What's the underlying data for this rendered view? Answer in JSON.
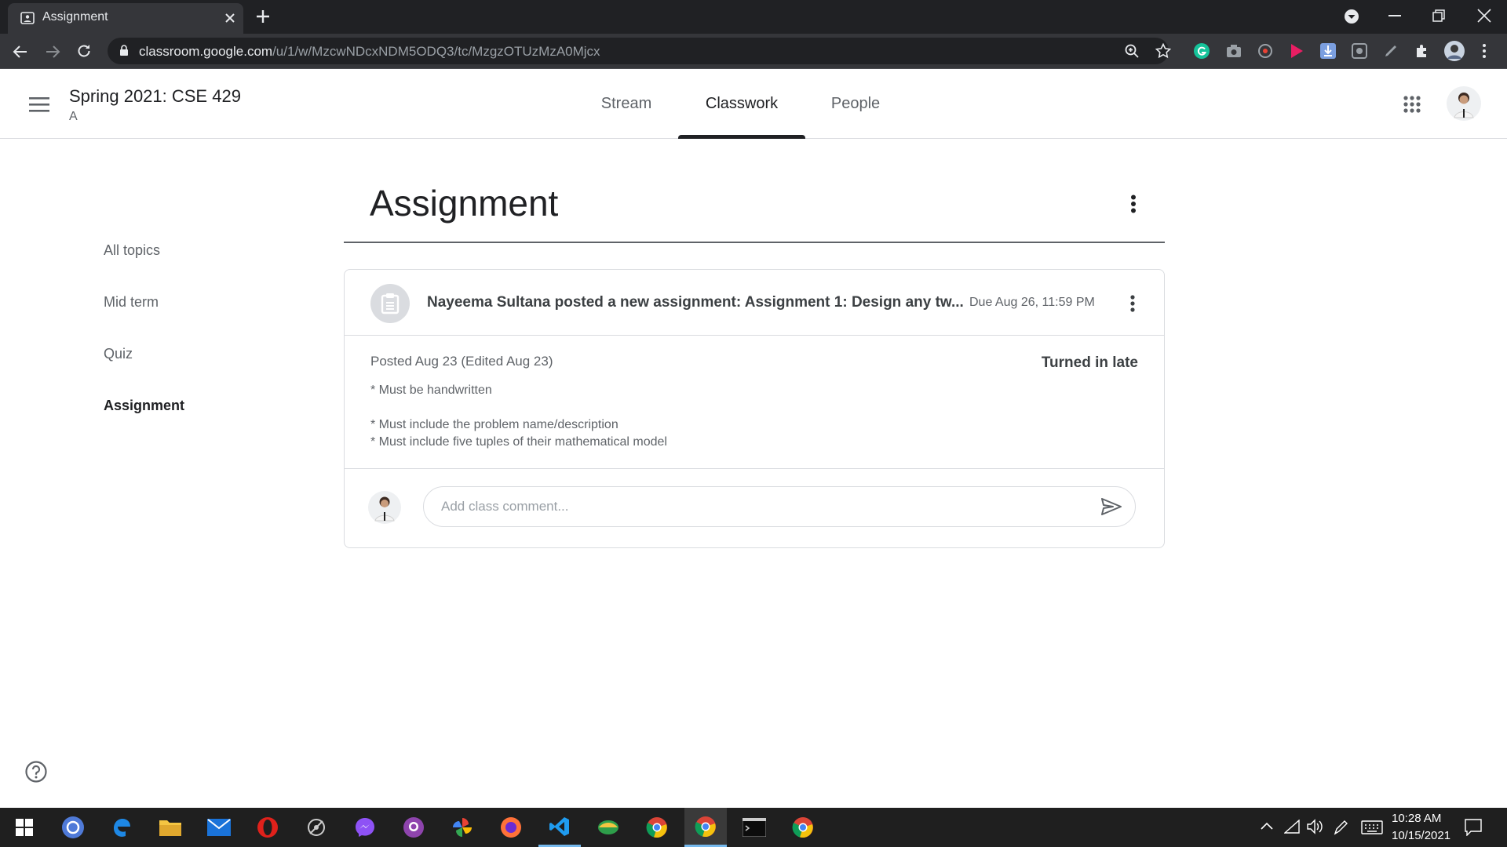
{
  "browser": {
    "tab_title": "Assignment",
    "url_domain": "classroom.google.com",
    "url_path": "/u/1/w/MzcwNDcxNDM5ODQ3/tc/MzgzOTUzMzA0Mjcx"
  },
  "class": {
    "name": "Spring 2021: CSE 429",
    "section": "A"
  },
  "nav_tabs": [
    {
      "label": "Stream"
    },
    {
      "label": "Classwork"
    },
    {
      "label": "People"
    }
  ],
  "topics": [
    {
      "label": "All topics"
    },
    {
      "label": "Mid term"
    },
    {
      "label": "Quiz"
    },
    {
      "label": "Assignment"
    }
  ],
  "section_title": "Assignment",
  "assignment": {
    "headline": "Nayeema Sultana posted a new assignment: Assignment 1: Design any tw...",
    "due": "Due Aug 26, 11:59 PM",
    "posted": "Posted Aug 23 (Edited Aug 23)",
    "status": "Turned in late",
    "instructions": [
      "* Must be handwritten",
      "* Must include the problem name/description",
      "* Must include five tuples of their mathematical model"
    ],
    "comment_placeholder": "Add class comment..."
  },
  "taskbar": {
    "time": "10:28 AM",
    "date": "10/15/2021"
  },
  "colors": {
    "chrome_dark": "#202124",
    "chrome_toolbar": "#35363a",
    "accent_text": "#202124",
    "muted_text": "#5f6368",
    "divider": "#dadce0"
  }
}
